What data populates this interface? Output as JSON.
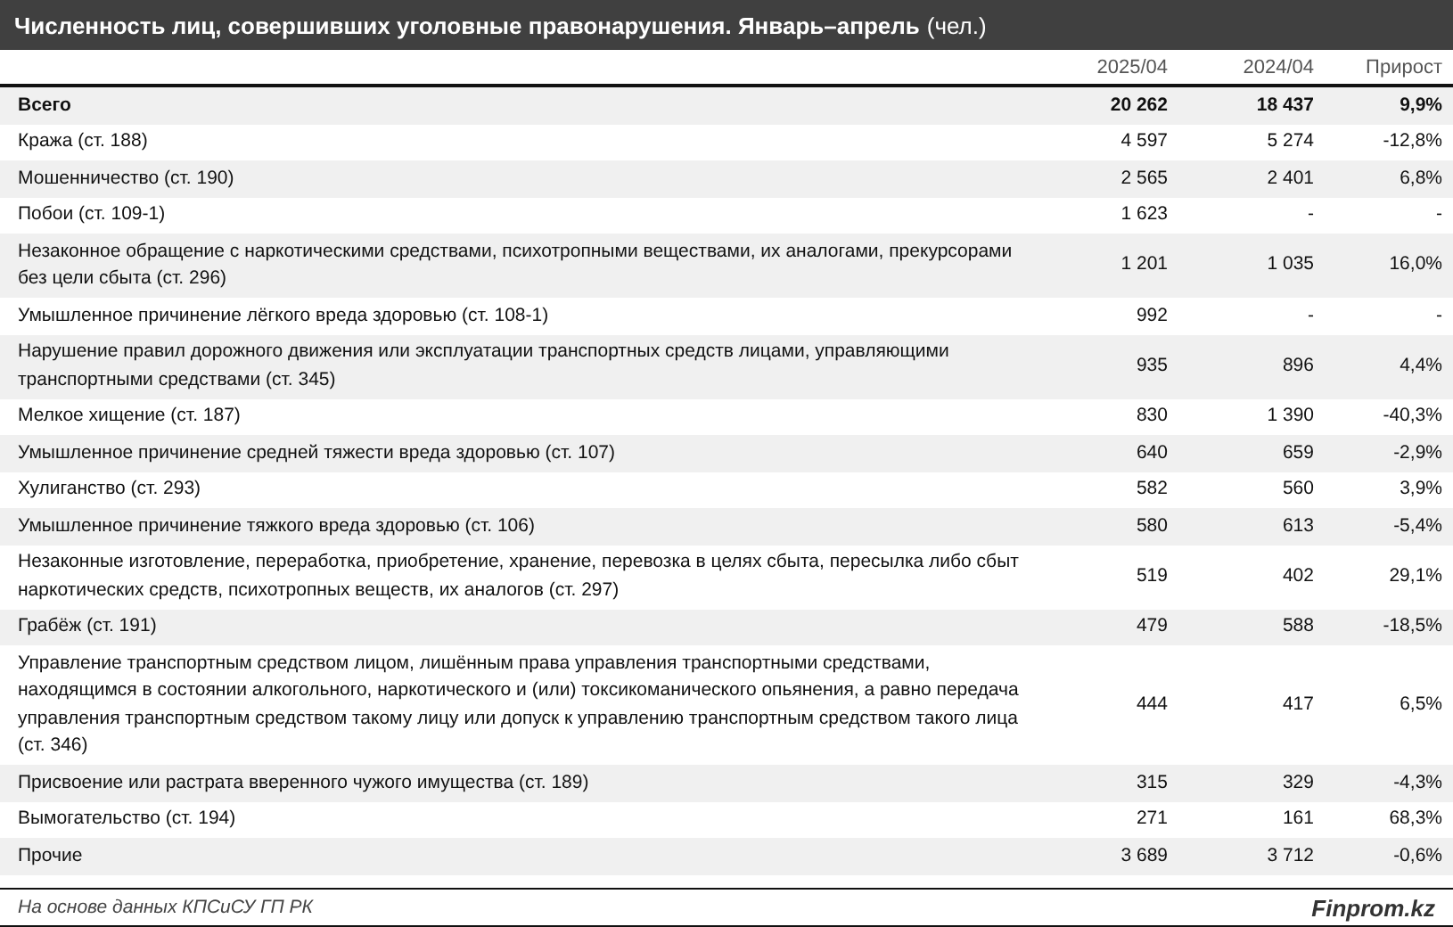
{
  "title": {
    "main": "Численность лиц, совершивших уголовные правонарушения. Январь–апрель",
    "unit": "(чел.)"
  },
  "columns": [
    "2025/04",
    "2024/04",
    "Прирост"
  ],
  "rows": [
    {
      "name": "Всего",
      "kind": "total",
      "values": [
        "20 262",
        "18 437",
        "9,9%"
      ]
    },
    {
      "name": "Кража (ст. 188)",
      "kind": "item",
      "values": [
        "4 597",
        "5 274",
        "-12,8%"
      ]
    },
    {
      "name": "Мошенничество (ст. 190)",
      "kind": "item",
      "values": [
        "2 565",
        "2 401",
        "6,8%"
      ]
    },
    {
      "name": "Побои (ст. 109-1)",
      "kind": "item",
      "values": [
        "1 623",
        "-",
        "-"
      ]
    },
    {
      "name": "Незаконное обращение с наркотическими средствами, психотропными веществами, их аналогами, прекурсорами без цели сбыта (ст. 296)",
      "kind": "item",
      "values": [
        "1 201",
        "1 035",
        "16,0%"
      ]
    },
    {
      "name": "Умышленное причинение лёгкого вреда здоровью (ст. 108-1)",
      "kind": "item",
      "values": [
        "992",
        "-",
        "-"
      ]
    },
    {
      "name": "Нарушение правил дорожного движения или эксплуатации транспортных средств лицами, управляющими транспортными средствами (ст. 345)",
      "kind": "item",
      "values": [
        "935",
        "896",
        "4,4%"
      ]
    },
    {
      "name": "Мелкое хищение (ст. 187)",
      "kind": "item",
      "values": [
        "830",
        "1 390",
        "-40,3%"
      ]
    },
    {
      "name": "Умышленное причинение средней тяжести вреда здоровью (ст. 107)",
      "kind": "item",
      "values": [
        "640",
        "659",
        "-2,9%"
      ]
    },
    {
      "name": "Хулиганство (ст. 293)",
      "kind": "item",
      "values": [
        "582",
        "560",
        "3,9%"
      ]
    },
    {
      "name": "Умышленное причинение тяжкого вреда здоровью (ст. 106)",
      "kind": "item",
      "values": [
        "580",
        "613",
        "-5,4%"
      ]
    },
    {
      "name": "Незаконные изготовление, переработка, приобретение, хранение, перевозка в целях сбыта, пересылка либо сбыт наркотических средств, психотропных веществ, их аналогов (ст. 297)",
      "kind": "item",
      "values": [
        "519",
        "402",
        "29,1%"
      ]
    },
    {
      "name": "Грабёж (ст. 191)",
      "kind": "item",
      "values": [
        "479",
        "588",
        "-18,5%"
      ]
    },
    {
      "name": "Управление транспортным средством лицом, лишённым права управления транспортными средствами, находящимся в состоянии алкогольного, наркотического и (или) токсикоманического опьянения, а равно передача управления транспортным средством такому лицу или допуск к управлению транспортным средством такого лица (ст. 346)",
      "kind": "item",
      "values": [
        "444",
        "417",
        "6,5%"
      ]
    },
    {
      "name": "Присвоение или растрата вверенного чужого имущества (ст. 189)",
      "kind": "item",
      "values": [
        "315",
        "329",
        "-4,3%"
      ]
    },
    {
      "name": "Вымогательство (ст. 194)",
      "kind": "item",
      "values": [
        "271",
        "161",
        "68,3%"
      ]
    },
    {
      "name": "Прочие",
      "kind": "item",
      "values": [
        "3 689",
        "3 712",
        "-0,6%"
      ]
    }
  ],
  "footer": {
    "source": "На основе данных КПСиСУ ГП РК",
    "brand": "Finprom.kz"
  }
}
